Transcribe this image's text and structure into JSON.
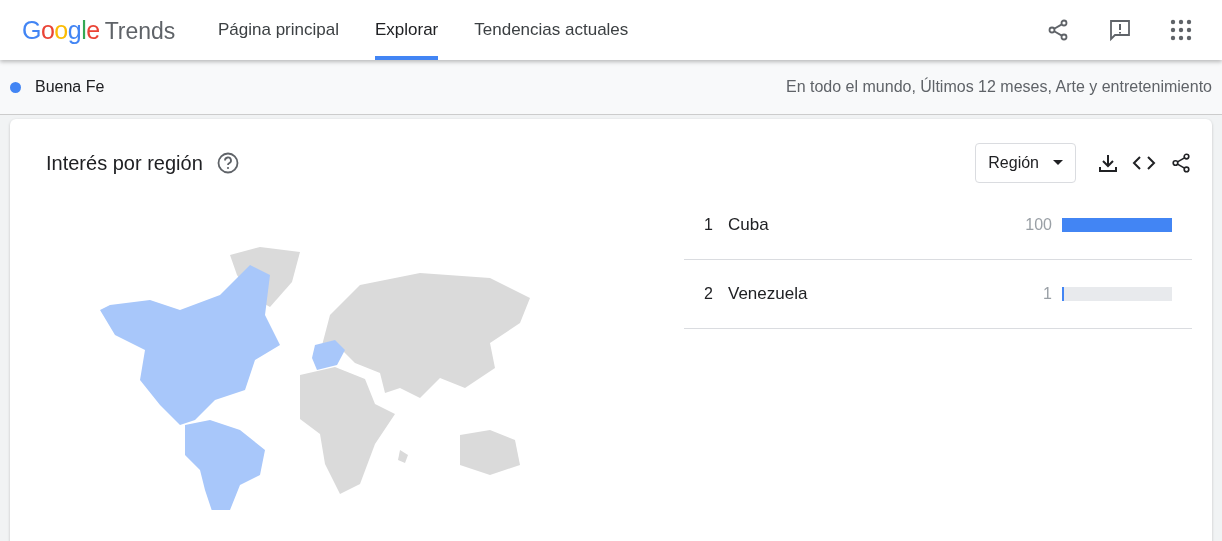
{
  "header": {
    "logo": {
      "brand": "Google",
      "product": "Trends"
    },
    "nav": [
      {
        "label": "Página principal",
        "selected": false
      },
      {
        "label": "Explorar",
        "selected": true
      },
      {
        "label": "Tendencias actuales",
        "selected": false
      }
    ]
  },
  "term_bar": {
    "term": "Buena Fe",
    "color": "#4285f4",
    "filters": "En todo el mundo, Últimos 12 meses, Arte y entretenimiento"
  },
  "card": {
    "title": "Interés por región",
    "dropdown": "Región",
    "rows": [
      {
        "rank": "1",
        "name": "Cuba",
        "value": "100",
        "level": 1
      },
      {
        "rank": "2",
        "name": "Venezuela",
        "value": "1",
        "level": 0.01
      }
    ]
  }
}
